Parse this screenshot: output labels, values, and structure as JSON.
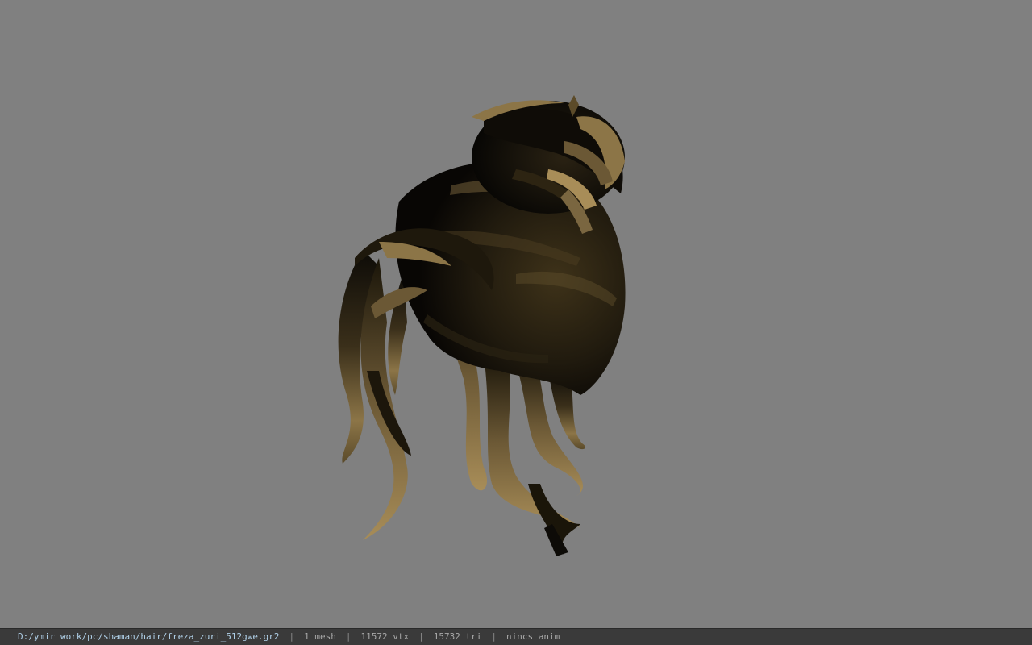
{
  "viewport": {
    "background": "#808080",
    "model": "hair-mesh-render",
    "hair_colors": {
      "dark": "#0d0b07",
      "mid": "#3a2f1a",
      "light": "#8c7547",
      "highlight": "#a88d58"
    }
  },
  "statusbar": {
    "file_path": "D:/ymir work/pc/shaman/hair/freza_zuri_512gwe.gr2",
    "mesh_count": "1 mesh",
    "vertex_count": "11572 vtx",
    "triangle_count": "15732 tri",
    "anim_status": "nincs anim",
    "separator": "|"
  }
}
